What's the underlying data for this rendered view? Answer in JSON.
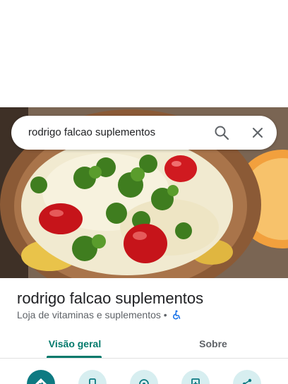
{
  "search": {
    "query": "rodrigo falcao suplementos",
    "search_icon": "search-icon",
    "clear_icon": "close-icon"
  },
  "place": {
    "name": "rodrigo falcao suplementos",
    "category": "Loja de vitaminas e suplementos",
    "separator": "•",
    "accessibility_icon": "wheelchair-icon"
  },
  "tabs": [
    {
      "label": "Visão geral",
      "active": true
    },
    {
      "label": "Sobre",
      "active": false
    }
  ],
  "actions": [
    {
      "icon": "directions-icon",
      "primary": true
    },
    {
      "icon": "phone-icon",
      "primary": false
    },
    {
      "icon": "nearby-icon",
      "primary": false
    },
    {
      "icon": "save-icon",
      "primary": false
    },
    {
      "icon": "share-icon",
      "primary": false
    }
  ],
  "colors": {
    "accent": "#00796b",
    "primary_action": "#0e7a82",
    "action_bg": "#d7eef0",
    "accessibility": "#1a73e8"
  }
}
